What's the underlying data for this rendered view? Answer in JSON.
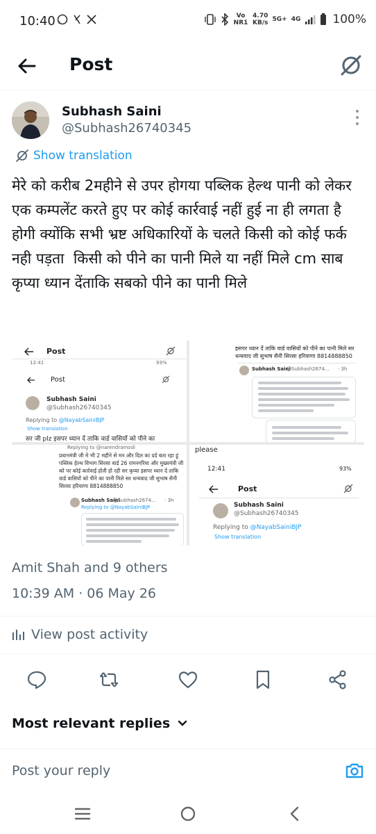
{
  "status_bar": {
    "time": "10:40",
    "left_icons": [
      "whatsapp-icon",
      "missed-call-icon",
      "x-icon"
    ],
    "network_label": "Vo NR1",
    "speed_value": "4.70",
    "speed_unit": "KB/s",
    "net_5g": "5G+",
    "net_4g": "4G",
    "battery": "100%"
  },
  "header": {
    "title": "Post"
  },
  "author": {
    "name": "Subhash Saini",
    "handle": "@Subhash26740345"
  },
  "translate_label": "Show translation",
  "post_text": "मेरे को करीब 2महीने से उपर होगया पब्लिक हेल्थ पानी को लेकर एक कम्पलेंट करते हुए पर कोई कार्रवाई नहीं हुई ना ही लगता है होगी क्योंकि सभी भ्रष्ट अधिकारियों के चलते किसी को कोई फर्क नही पड़ता  किसी को पीने का पानी मिले या नहीं मिले cm साब कृप्या ध्यान देंताकि सबको पीने का पानी मिले",
  "media": {
    "tile1": {
      "header": "Post",
      "status": "12:41",
      "battery": "93%",
      "inner_header": "Post",
      "name": "Subhash Saini",
      "handle": "@Subhash26740345",
      "replying_prefix": "Replying to ",
      "replying_handle": "@NayabSainiBJP",
      "translate": "Show translation",
      "text": "सर जी plz इसपर ध्यान दें ताकि वार्ड वासियों को पीने का"
    },
    "tile2": {
      "text": "इसपर ध्यान दें ताकि वार्ड वासियों को पीने का पानी मिले सर धन्यवाद जी सुभाष सैनी सिरसा हरियाणा 8814888850",
      "name": "Subhash Saini",
      "handle": "@Subhash2674...",
      "time": "· 3h"
    },
    "tile3": {
      "replying": "Replying to @narendramodi",
      "text": "प्रधानमंत्री जी मे भी 2 महीने से मन और दिल का दर्द बता रहा हूं पब्लिक हेल्थ विभाग सिरसा वार्ड 26 रामनगरिया और मुख्यमंत्री जी को पर कोई कार्रवाई होती हो रही सर कृप्या इसपर ध्यान दें ताकि वार्ड वासियों को पीने का पानी मिले सर धन्यवाद जी सुभाष सैनी सिरसा हरियाणा 8814888850",
      "name": "Subhash Saini",
      "handle": "@Subhash2674...",
      "time": "· 3h",
      "replying2": "Replying to @NayabSainiBJP"
    },
    "tile4": {
      "top_text": "please",
      "status": "12:41",
      "battery": "93%",
      "header": "Post",
      "name": "Subhash Saini",
      "handle": "@Subhash26740345",
      "replying_prefix": "Replying to ",
      "replying_handle": "@NayabSainiBJP",
      "translate": "Show translation"
    }
  },
  "likers": "Amit Shah and 9 others",
  "timestamp": "10:39 AM · 06 May 26",
  "activity_label": "View post activity",
  "actions": [
    "reply-icon",
    "repost-icon",
    "like-icon",
    "bookmark-icon",
    "share-icon"
  ],
  "sort_label": "Most relevant replies",
  "reply_placeholder": "Post your reply",
  "nav": [
    "recents-icon",
    "home-icon",
    "back-icon"
  ],
  "colors": {
    "accent": "#1d9bf0",
    "text": "#0f1419",
    "secondary": "#536471"
  }
}
